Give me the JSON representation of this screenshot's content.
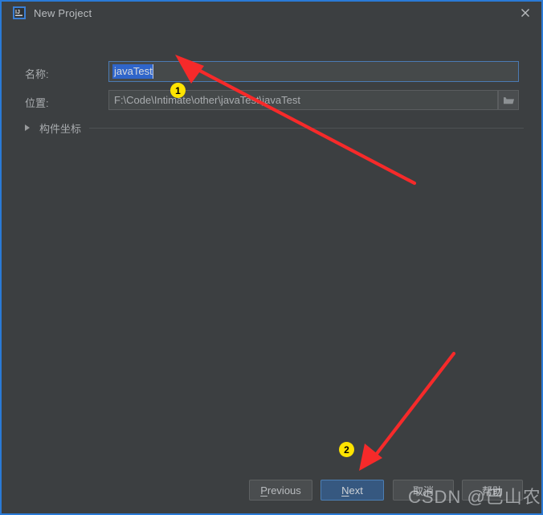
{
  "window": {
    "title": "New Project",
    "app_icon": "intellij-idea-icon",
    "close_icon": "close-icon",
    "border_color": "#2a7ad6",
    "background": "#3c3f41"
  },
  "form": {
    "name_label": "名称:",
    "name_value": "javaTest",
    "name_field_selected": true,
    "location_label": "位置:",
    "location_value": "F:\\Code\\Intimate\\other\\javaTest\\javaTest",
    "browse_icon": "folder-icon",
    "section": {
      "label": "构件坐标",
      "expanded": false,
      "chevron_icon": "triangle-right-icon"
    }
  },
  "buttons": {
    "previous": {
      "label": "Previous",
      "mnemonic": "P",
      "primary": false
    },
    "next": {
      "label": "Next",
      "mnemonic": "N",
      "primary": true,
      "color": "#365880"
    },
    "cancel": {
      "label": "取消",
      "primary": false
    },
    "help": {
      "label": "帮助",
      "primary": false
    }
  },
  "annotations": {
    "accent_color": "#f62a2a",
    "badge_color": "#ffe400",
    "steps": [
      {
        "number": "1",
        "target": "name-input"
      },
      {
        "number": "2",
        "target": "next-button"
      }
    ]
  },
  "watermark": {
    "text": "CSDN @巴山农夫"
  }
}
